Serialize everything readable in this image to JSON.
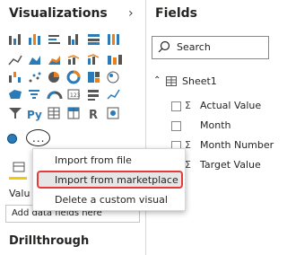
{
  "visualizations": {
    "title": "Visualizations",
    "value_label": "Valu",
    "add_fields_placeholder": "Add data fields here",
    "drillthrough_title": "Drillthrough"
  },
  "fields": {
    "title": "Fields",
    "search_placeholder": "Search",
    "table_name": "Sheet1",
    "items": [
      {
        "label": "Actual Value",
        "sigma": true
      },
      {
        "label": "Month",
        "sigma": false
      },
      {
        "label": "Month Number",
        "sigma": true
      },
      {
        "label": "Target Value",
        "sigma": true
      }
    ]
  },
  "menu": {
    "items": [
      "Import from file",
      "Import from marketplace",
      "Delete a custom visual"
    ],
    "highlighted": "Import from marketplace"
  },
  "more_button": {
    "label": "..."
  },
  "colors": {
    "accent": "#f2c811",
    "highlight_border": "#e23b3b",
    "chart_blue": "#2b7bb9",
    "chart_orange": "#e8801e"
  }
}
